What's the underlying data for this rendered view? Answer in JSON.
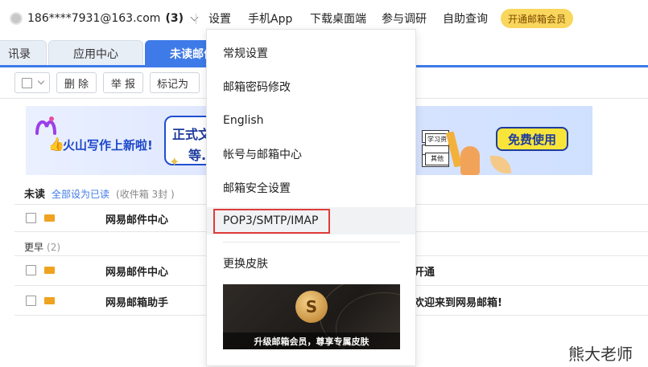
{
  "header": {
    "account": "186****7931@163.com",
    "unread_count": "(3)",
    "nav": [
      "设置",
      "手机App",
      "下载桌面端",
      "参与调研",
      "自助查询"
    ],
    "vip_label": "开通邮箱会员"
  },
  "tabs": [
    {
      "label": "讯录"
    },
    {
      "label": "应用中心"
    },
    {
      "label": "未读邮件"
    }
  ],
  "toolbar": {
    "delete": "删 除",
    "report": "举 报",
    "mark_as": "标记为"
  },
  "banner": {
    "title": "火山写作上新啦!",
    "bubble_line1": "正式文",
    "bubble_line2": "等.",
    "cells": [
      "学习资",
      "其他"
    ],
    "cta": "免费使用"
  },
  "unread": {
    "title": "未读",
    "mark_all": "全部设为已读",
    "info": "(收件箱 3封 )"
  },
  "earlier": {
    "title": "更早",
    "count": "(2)"
  },
  "rows": [
    {
      "sender": "网易邮件中心",
      "subject": ""
    },
    {
      "sender": "网易邮件中心",
      "subject": "开通"
    },
    {
      "sender": "网易邮箱助手",
      "subject": "欢迎来到网易邮箱!"
    }
  ],
  "dropdown": {
    "items": [
      "常规设置",
      "邮箱密码修改",
      "English",
      "帐号与邮箱中心",
      "邮箱安全设置",
      "POP3/SMTP/IMAP",
      "更换皮肤"
    ],
    "skin_caption": "升级邮箱会员，尊享专属皮肤",
    "coin_symbol": "S"
  },
  "watermark": "熊大老师",
  "colors": {
    "accent": "#3e7ae8",
    "highlight_border": "#e03b3b",
    "vip": "#f9d65c",
    "envelope": "#efa320"
  }
}
